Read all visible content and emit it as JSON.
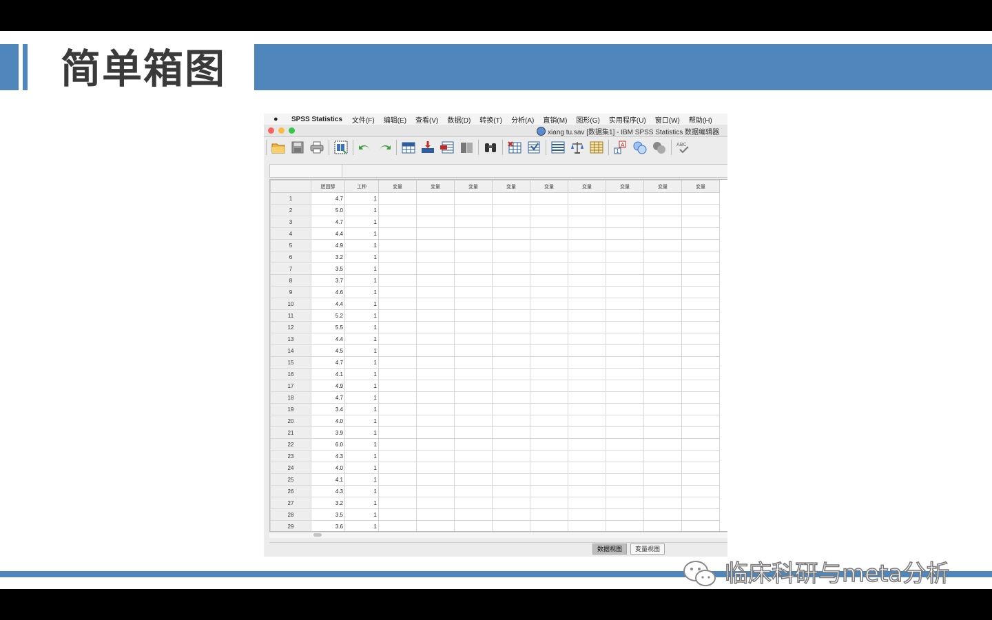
{
  "slide": {
    "title": "简单箱图",
    "watermark": "临床科研与meta分析",
    "colors": {
      "accent": "#4f86bb",
      "background": "#ffffff",
      "frame": "#000000"
    }
  },
  "spss": {
    "menubar": {
      "app": "SPSS Statistics",
      "items": [
        "文件(F)",
        "编辑(E)",
        "查看(V)",
        "数据(D)",
        "转换(T)",
        "分析(A)",
        "直销(M)",
        "图形(G)",
        "实用程序(U)",
        "窗口(W)",
        "帮助(H)"
      ]
    },
    "window_title": "xiang tu.sav [数据集1] - IBM SPSS Statistics 数据编辑器",
    "toolbar_icons": [
      "open-folder-icon",
      "save-icon",
      "print-icon",
      "dialog-recall-icon",
      "undo-icon",
      "redo-icon",
      "goto-case-icon",
      "goto-variable-icon",
      "variables-icon",
      "split-icon",
      "find-icon",
      "insert-cases-icon",
      "insert-variable-icon",
      "split-file-icon",
      "weight-cases-icon",
      "select-cases-icon",
      "value-labels-icon",
      "use-sets-icon",
      "show-sets-icon",
      "spell-check-icon"
    ],
    "columns": [
      "胆固醇",
      "工种",
      "变量",
      "变量",
      "变量",
      "变量",
      "变量",
      "变量",
      "变量",
      "变量",
      "变量"
    ],
    "rows": [
      [
        "1",
        "4.7",
        "1"
      ],
      [
        "2",
        "5.0",
        "1"
      ],
      [
        "3",
        "4.7",
        "1"
      ],
      [
        "4",
        "4.4",
        "1"
      ],
      [
        "5",
        "4.9",
        "1"
      ],
      [
        "6",
        "3.2",
        "1"
      ],
      [
        "7",
        "3.5",
        "1"
      ],
      [
        "8",
        "3.7",
        "1"
      ],
      [
        "9",
        "4.6",
        "1"
      ],
      [
        "10",
        "4.4",
        "1"
      ],
      [
        "11",
        "5.2",
        "1"
      ],
      [
        "12",
        "5.5",
        "1"
      ],
      [
        "13",
        "4.4",
        "1"
      ],
      [
        "14",
        "4.5",
        "1"
      ],
      [
        "15",
        "4.7",
        "1"
      ],
      [
        "16",
        "4.1",
        "1"
      ],
      [
        "17",
        "4.9",
        "1"
      ],
      [
        "18",
        "4.7",
        "1"
      ],
      [
        "19",
        "3.4",
        "1"
      ],
      [
        "20",
        "4.0",
        "1"
      ],
      [
        "21",
        "3.9",
        "1"
      ],
      [
        "22",
        "6.0",
        "1"
      ],
      [
        "23",
        "4.3",
        "1"
      ],
      [
        "24",
        "4.0",
        "1"
      ],
      [
        "25",
        "4.1",
        "1"
      ],
      [
        "26",
        "4.3",
        "1"
      ],
      [
        "27",
        "3.2",
        "1"
      ],
      [
        "28",
        "3.5",
        "1"
      ],
      [
        "29",
        "3.6",
        "1"
      ]
    ],
    "tabs": {
      "data_view": "数据视图",
      "variable_view": "变量视图",
      "active": "data_view"
    }
  }
}
